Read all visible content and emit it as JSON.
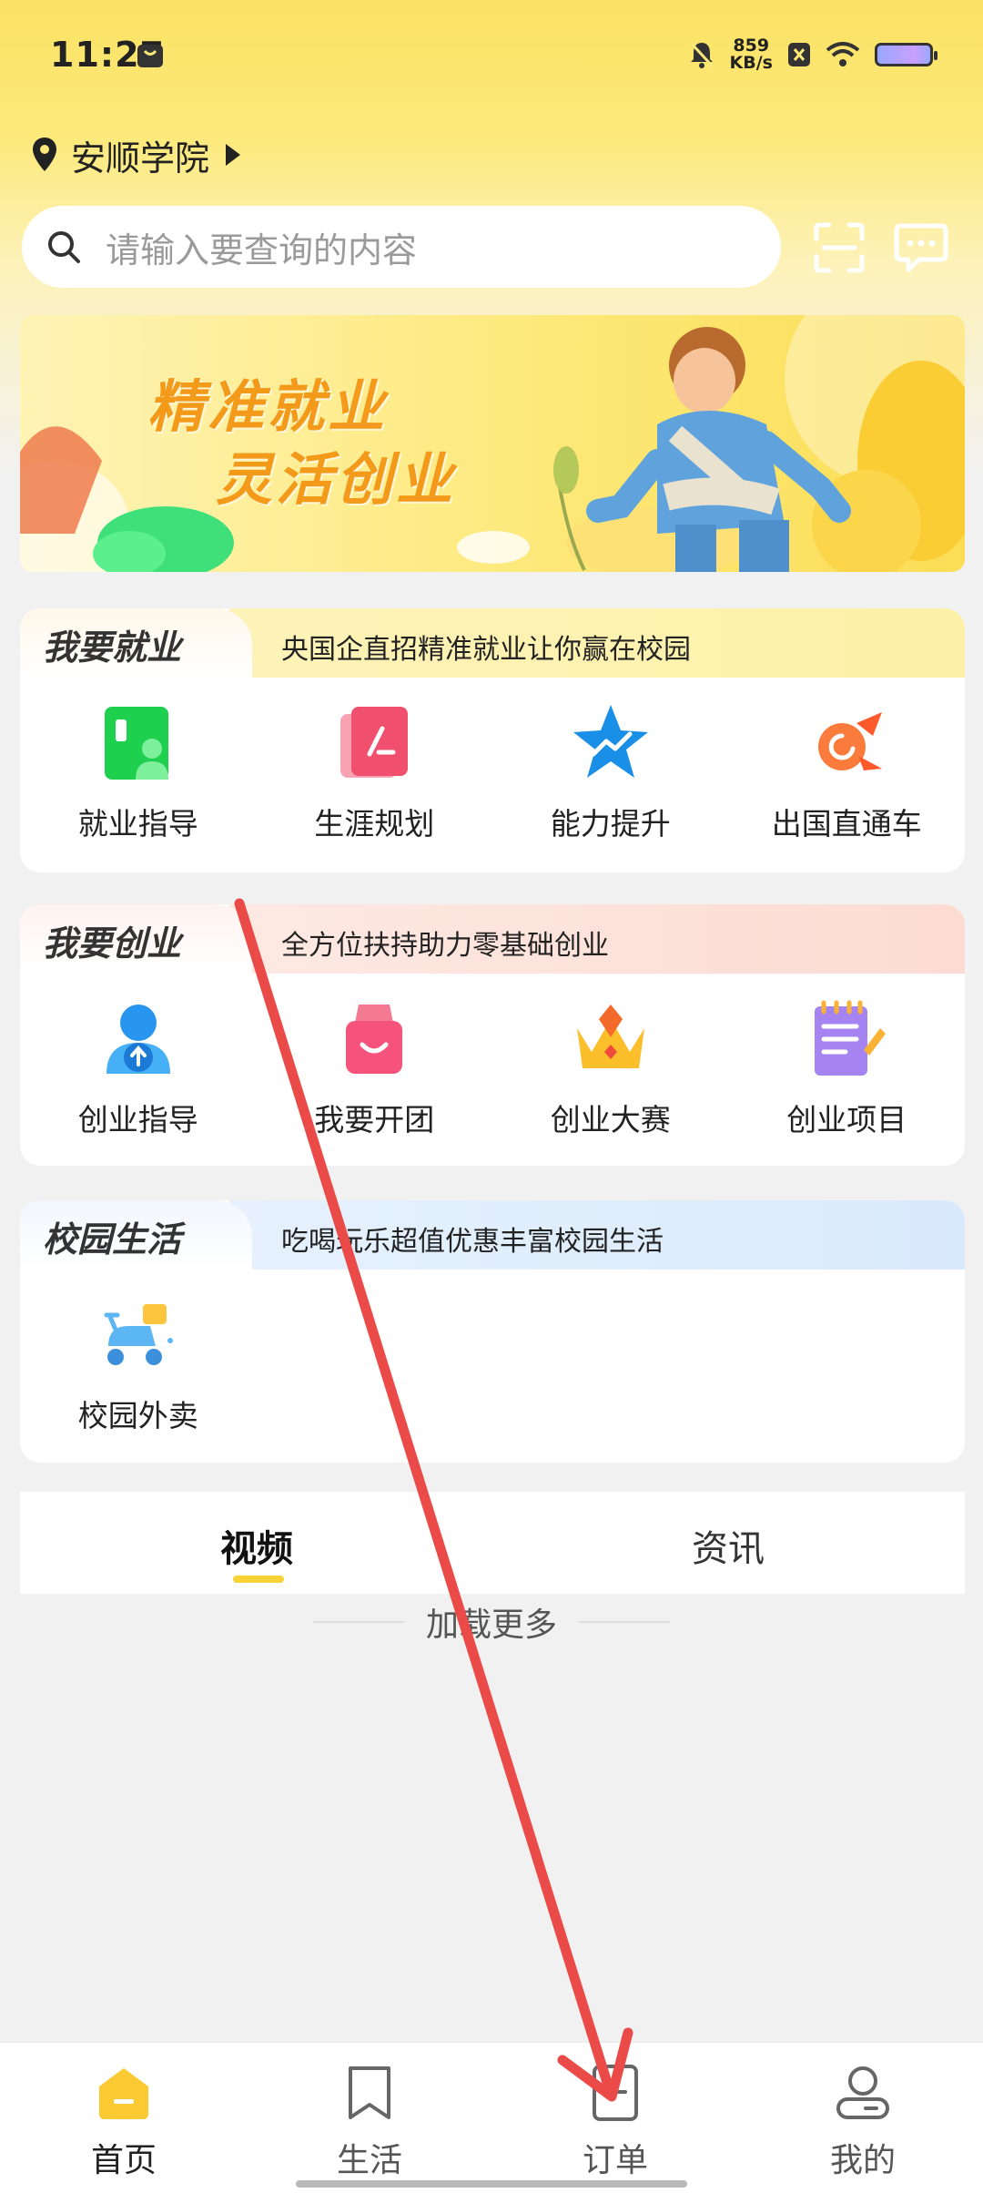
{
  "status_bar": {
    "time": "11:27",
    "net_speed_value": "859",
    "net_speed_unit": "KB/s"
  },
  "header": {
    "location": "安顺学院",
    "search_placeholder": "请输入要查询的内容"
  },
  "banner": {
    "line1": "精准就业",
    "line2": "灵活创业"
  },
  "sections": {
    "employment": {
      "title": "我要就业",
      "subtitle": "央国企直招精准就业让你赢在校园",
      "items": [
        {
          "label": "就业指导",
          "icon": "id-card-icon"
        },
        {
          "label": "生涯规划",
          "icon": "pen-card-icon"
        },
        {
          "label": "能力提升",
          "icon": "star-trend-icon"
        },
        {
          "label": "出国直通车",
          "icon": "plane-icon"
        }
      ]
    },
    "startup": {
      "title": "我要创业",
      "subtitle": "全方位扶持助力零基础创业",
      "items": [
        {
          "label": "创业指导",
          "icon": "user-up-icon"
        },
        {
          "label": "我要开团",
          "icon": "shopping-bag-icon"
        },
        {
          "label": "创业大赛",
          "icon": "crown-icon"
        },
        {
          "label": "创业项目",
          "icon": "notepad-icon"
        }
      ]
    },
    "campus": {
      "title": "校园生活",
      "subtitle": "吃喝玩乐超值优惠丰富校园生活",
      "items": [
        {
          "label": "校园外卖",
          "icon": "scooter-icon"
        }
      ]
    }
  },
  "tabs": {
    "video": "视频",
    "news": "资讯",
    "active": "视频"
  },
  "load_more": "加载更多",
  "bottom_nav": {
    "home": "首页",
    "life": "生活",
    "orders": "订单",
    "mine": "我的",
    "active": "首页"
  },
  "colors": {
    "brand_yellow": "#fbe264",
    "accent_orange": "#f39a1b",
    "annotation_red": "#ea4b48"
  }
}
